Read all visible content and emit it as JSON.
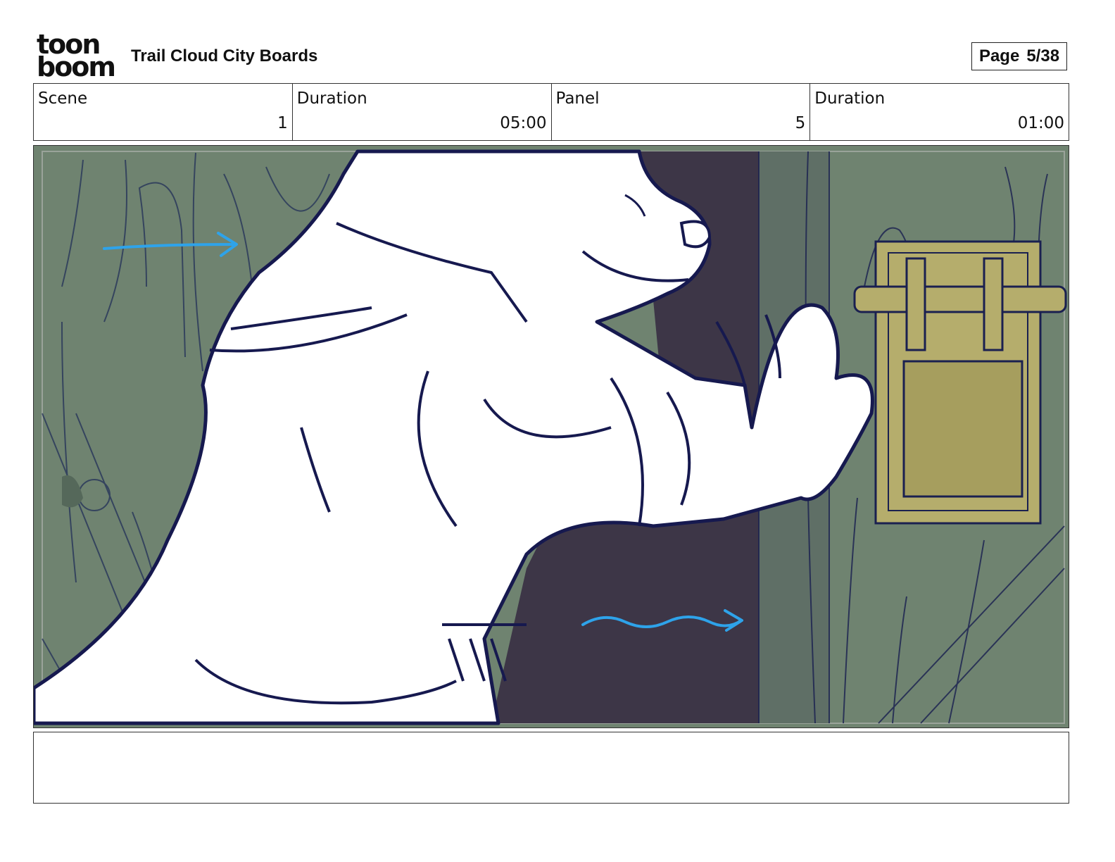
{
  "header": {
    "logo_line1": "toon",
    "logo_line2": "boom",
    "title": "Trail Cloud City Boards",
    "page_label": "Page",
    "page_value": "5/38"
  },
  "info": {
    "scene_label": "Scene",
    "scene_value": "1",
    "scene_duration_label": "Duration",
    "scene_duration_value": "05:00",
    "panel_label": "Panel",
    "panel_value": "5",
    "panel_duration_label": "Duration",
    "panel_duration_value": "01:00"
  },
  "notes": {
    "text": ""
  },
  "colors": {
    "wood_green": "#6f8370",
    "wood_dark": "#55685a",
    "shadow_purple": "#3d3647",
    "ink": "#16194f",
    "brass": "#b5ad6c",
    "arrow_blue": "#2ea3ea"
  }
}
